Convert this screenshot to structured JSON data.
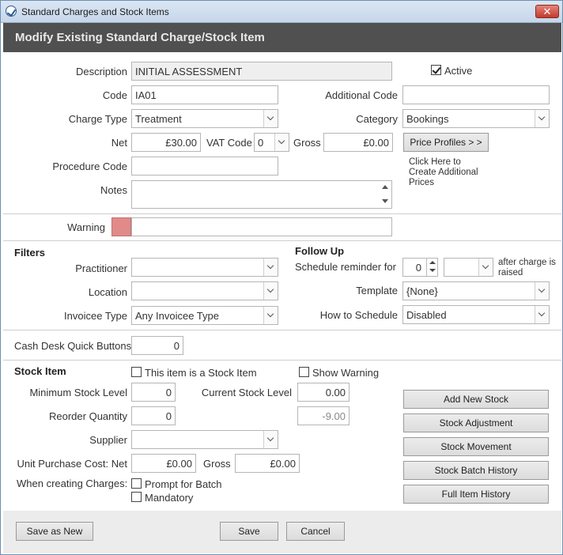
{
  "window": {
    "title": "Standard Charges and Stock Items",
    "close_glyph": "✕"
  },
  "header": {
    "title": "Modify Existing Standard Charge/Stock Item"
  },
  "main": {
    "description_label": "Description",
    "description_value": "INITIAL ASSESSMENT",
    "active_label": "Active",
    "active_checked": true,
    "code_label": "Code",
    "code_value": "IA01",
    "additional_code_label": "Additional Code",
    "additional_code_value": "",
    "charge_type_label": "Charge Type",
    "charge_type_value": "Treatment",
    "category_label": "Category",
    "category_value": "Bookings",
    "net_label": "Net",
    "net_value": "£30.00",
    "vat_code_label": "VAT Code",
    "vat_code_value": "0",
    "gross_label": "Gross",
    "gross_value": "£0.00",
    "price_profiles_button": "Price Profiles > >",
    "price_profiles_hint_1": "Click Here to",
    "price_profiles_hint_2": "Create Additional",
    "price_profiles_hint_3": "Prices",
    "procedure_code_label": "Procedure Code",
    "procedure_code_value": "",
    "notes_label": "Notes",
    "notes_value": ""
  },
  "warning": {
    "label": "Warning",
    "value": "",
    "swatch_color": "#e08a8a"
  },
  "filters": {
    "heading": "Filters",
    "practitioner_label": "Practitioner",
    "practitioner_value": "",
    "location_label": "Location",
    "location_value": "",
    "invoicee_type_label": "Invoicee Type",
    "invoicee_type_value": "Any Invoicee Type"
  },
  "follow_up": {
    "heading": "Follow Up",
    "schedule_label": "Schedule reminder for",
    "schedule_value": "0",
    "schedule_unit_value": "",
    "after_1": "after charge is",
    "after_2": "raised",
    "template_label": "Template",
    "template_value": "{None}",
    "how_label": "How to Schedule",
    "how_value": "Disabled"
  },
  "cash_desk": {
    "label": "Cash Desk Quick Buttons",
    "value": "0"
  },
  "stock": {
    "heading": "Stock Item",
    "is_stock_label": "This item is a Stock Item",
    "is_stock_checked": false,
    "show_warning_label": "Show Warning",
    "show_warning_checked": false,
    "min_level_label": "Minimum Stock Level",
    "min_level_value": "0",
    "current_level_label": "Current Stock Level",
    "current_level_value": "0.00",
    "reorder_label": "Reorder Quantity",
    "reorder_value": "0",
    "current_level_secondary": "-9.00",
    "supplier_label": "Supplier",
    "supplier_value": "",
    "unit_cost_label": "Unit Purchase Cost: Net",
    "unit_cost_value": "£0.00",
    "unit_gross_label": "Gross",
    "unit_gross_value": "£0.00",
    "creating_label": "When creating Charges:",
    "prompt_batch_label": "Prompt for Batch",
    "mandatory_label": "Mandatory",
    "add_new_stock": "Add New Stock",
    "stock_adjustment": "Stock Adjustment",
    "stock_movement": "Stock Movement",
    "stock_batch_history": "Stock Batch History",
    "full_item_history": "Full Item History"
  },
  "footer": {
    "save_as_new": "Save as New",
    "save": "Save",
    "cancel": "Cancel"
  }
}
